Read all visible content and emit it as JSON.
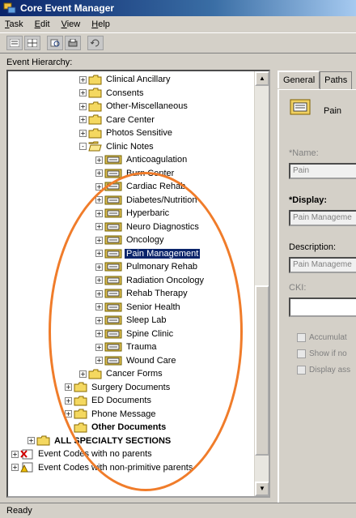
{
  "window": {
    "title": "Core Event Manager"
  },
  "menu": [
    "Task",
    "Edit",
    "View",
    "Help"
  ],
  "toolbar": {
    "icons": [
      "list-icon",
      "grid-icon",
      "print-preview-icon",
      "print-icon",
      "refresh-icon"
    ]
  },
  "left_panel": {
    "header": "Event Hierarchy:"
  },
  "tree": [
    {
      "label": "Clinical Ancillary",
      "icon": "folder-icon",
      "expand": "+",
      "level": 2
    },
    {
      "label": "Consents",
      "icon": "folder-icon",
      "expand": "+",
      "level": 2
    },
    {
      "label": "Other-Miscellaneous",
      "icon": "folder-icon",
      "expand": "+",
      "level": 2
    },
    {
      "label": "Care Center",
      "icon": "folder-icon",
      "expand": "+",
      "level": 2
    },
    {
      "label": "Photos Sensitive",
      "icon": "folder-icon",
      "expand": "+",
      "level": 2
    },
    {
      "label": "Clinic Notes",
      "icon": "open-folder-icon",
      "expand": "-",
      "level": 2
    },
    {
      "label": "Anticoagulation",
      "icon": "note-icon",
      "expand": "+",
      "level": 3
    },
    {
      "label": "Burn Center",
      "icon": "note-icon",
      "expand": "+",
      "level": 3
    },
    {
      "label": "Cardiac Rehab",
      "icon": "note-icon",
      "expand": "+",
      "level": 3
    },
    {
      "label": "Diabetes/Nutrition",
      "icon": "note-icon",
      "expand": "+",
      "level": 3
    },
    {
      "label": "Hyperbaric",
      "icon": "note-icon",
      "expand": "+",
      "level": 3
    },
    {
      "label": "Neuro Diagnostics",
      "icon": "note-icon",
      "expand": "+",
      "level": 3
    },
    {
      "label": "Oncology",
      "icon": "note-icon",
      "expand": "+",
      "level": 3
    },
    {
      "label": "Pain Management",
      "icon": "note-icon",
      "expand": "+",
      "level": 3,
      "selected": true
    },
    {
      "label": "Pulmonary Rehab",
      "icon": "note-icon",
      "expand": "+",
      "level": 3
    },
    {
      "label": "Radiation Oncology",
      "icon": "note-icon",
      "expand": "+",
      "level": 3
    },
    {
      "label": "Rehab Therapy",
      "icon": "note-icon",
      "expand": "+",
      "level": 3
    },
    {
      "label": "Senior Health",
      "icon": "note-icon",
      "expand": "+",
      "level": 3
    },
    {
      "label": "Sleep Lab",
      "icon": "note-icon",
      "expand": "+",
      "level": 3
    },
    {
      "label": "Spine Clinic",
      "icon": "note-icon",
      "expand": "+",
      "level": 3
    },
    {
      "label": "Trauma",
      "icon": "note-icon",
      "expand": "+",
      "level": 3
    },
    {
      "label": "Wound Care",
      "icon": "note-icon",
      "expand": "+",
      "level": 3
    },
    {
      "label": "Cancer Forms",
      "icon": "folder-icon",
      "expand": "+",
      "level": 2
    },
    {
      "label": "Surgery Documents",
      "icon": "folder-icon",
      "expand": "+",
      "level": 1
    },
    {
      "label": "ED Documents",
      "icon": "folder-icon",
      "expand": "+",
      "level": 1
    },
    {
      "label": "Phone Message",
      "icon": "folder-icon",
      "expand": "+",
      "level": 1
    },
    {
      "label": "Other Documents",
      "icon": "folder-icon",
      "expand": "",
      "level": 1,
      "bold": true
    },
    {
      "label": "ALL SPECIALTY SECTIONS",
      "icon": "folder-icon",
      "expand": "+",
      "level": 0,
      "bold": true
    },
    {
      "label": "Event Codes with no parents",
      "icon": "error-list-icon",
      "expand": "+",
      "level": -1
    },
    {
      "label": "Event Codes with non-primitive parents",
      "icon": "warning-list-icon",
      "expand": "+",
      "level": -1
    }
  ],
  "right_panel": {
    "tabs": [
      "General",
      "Paths"
    ],
    "header_text": "Pain",
    "name_label": "*Name:",
    "name_value": "Pain",
    "display_label": "*Display:",
    "display_value": "Pain Manageme",
    "description_label": "Description:",
    "description_value": "Pain Manageme",
    "cki_label": "CKI:",
    "cki_value": "",
    "checkboxes": [
      "Accumulat",
      "Show if no",
      "Display ass"
    ]
  },
  "status": {
    "text": "Ready"
  },
  "colors": {
    "titlebar": "#0a246a",
    "selection": "#0a246a",
    "highlight_ellipse": "#f07c2a",
    "face": "#d4d0c8"
  }
}
